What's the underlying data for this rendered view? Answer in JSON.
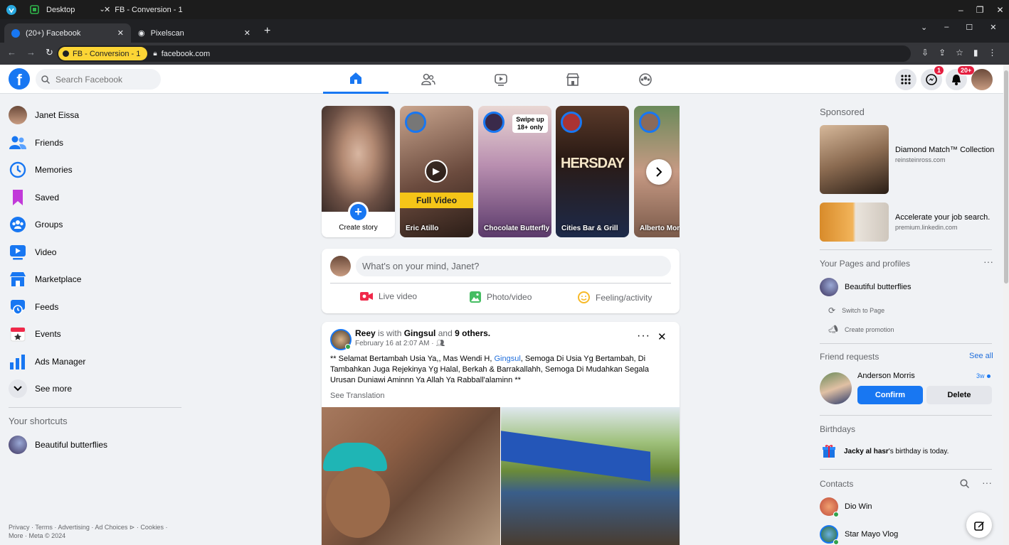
{
  "os": {
    "desktop_label": "Desktop",
    "window_title": "FB - Conversion - 1"
  },
  "browser": {
    "tabs": [
      {
        "label": "(20+) Facebook"
      },
      {
        "label": "Pixelscan"
      }
    ],
    "extension_label": "FB - Conversion - 1",
    "url": "facebook.com"
  },
  "fb": {
    "search_placeholder": "Search Facebook",
    "messenger_badge": "1",
    "notif_badge": "20+"
  },
  "left_nav": {
    "items": [
      {
        "label": "Janet Eissa",
        "icon": "profile-avatar"
      },
      {
        "label": "Friends",
        "icon": "friends-icon"
      },
      {
        "label": "Memories",
        "icon": "memories-icon"
      },
      {
        "label": "Saved",
        "icon": "saved-icon"
      },
      {
        "label": "Groups",
        "icon": "groups-icon"
      },
      {
        "label": "Video",
        "icon": "video-icon"
      },
      {
        "label": "Marketplace",
        "icon": "marketplace-icon"
      },
      {
        "label": "Feeds",
        "icon": "feeds-icon"
      },
      {
        "label": "Events",
        "icon": "events-icon"
      },
      {
        "label": "Ads Manager",
        "icon": "ads-manager-icon"
      },
      {
        "label": "See more",
        "icon": "chevron-down-icon"
      }
    ],
    "shortcuts_title": "Your shortcuts",
    "shortcuts": [
      {
        "label": "Beautiful butterflies"
      }
    ],
    "footer_line1": "Privacy · Terms · Advertising · Ad Choices ⊳ · Cookies ·",
    "footer_line2": "More · Meta © 2024"
  },
  "stories": [
    {
      "name": "Create story",
      "color": "#8a6f60"
    },
    {
      "name": "Eric Atillo",
      "color": "#6b4b3e",
      "overlay": "Full Video"
    },
    {
      "name": "Chocolate Butterfly",
      "color": "#b98fb0",
      "overlay": "Swipe up 18+ only"
    },
    {
      "name": "Cities Bar & Grill",
      "color": "#3a2a1f",
      "overlay": "HERSDAY"
    },
    {
      "name": "Alberto Mon",
      "color": "#a88a7a"
    }
  ],
  "composer": {
    "placeholder": "What's on your mind, Janet?",
    "actions": [
      "Live video",
      "Photo/video",
      "Feeling/activity"
    ]
  },
  "post": {
    "author": "Reey",
    "is_with": "is with",
    "tagged": "Gingsul",
    "and": "and",
    "others": "9 others.",
    "time": "February 16 at 2:07 AM ·",
    "text_a": "** Selamat Bertambah Usia Ya,,  Mas Wendi H, ",
    "text_link": "Gingsul",
    "text_b": ", Semoga Di Usia Yg Bertambah, Di Tambahkan Juga Rejekinya Yg Halal, Berkah & Barrakallahh, Semoga Di Mudahkan Segala Urusan Duniawi Aminnn Ya Allah Ya Rabball'alaminn **",
    "see_translation": "See Translation"
  },
  "right": {
    "sponsored_title": "Sponsored",
    "ads": [
      {
        "title": "Diamond Match™ Collection",
        "domain": "reinsteinross.com"
      },
      {
        "title": "Accelerate your job search.",
        "domain": "premium.linkedin.com"
      }
    ],
    "pages_title": "Your Pages and profiles",
    "page_name": "Beautiful butterflies",
    "switch_page": "Switch to Page",
    "create_promotion": "Create promotion",
    "friend_requests_title": "Friend requests",
    "see_all": "See all",
    "request_name": "Anderson Morris",
    "request_time": "3w",
    "confirm": "Confirm",
    "delete": "Delete",
    "birthdays_title": "Birthdays",
    "birthday_name": "Jacky al hasr",
    "birthday_text": "'s birthday is today.",
    "contacts_title": "Contacts",
    "contacts": [
      "Dio Win",
      "Star Mayo Vlog"
    ]
  },
  "colors": {
    "fb_blue": "#1877f2",
    "bg": "#f0f2f5"
  }
}
